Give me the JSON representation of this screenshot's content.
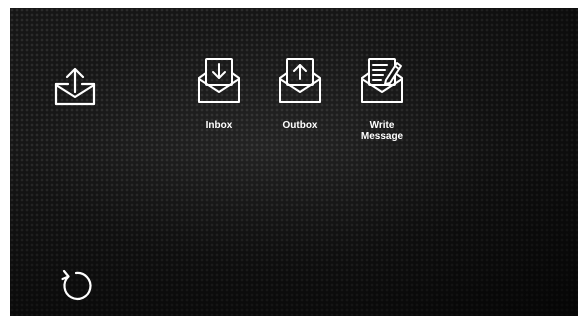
{
  "header": {
    "current_section_icon": "mail-share-icon"
  },
  "menu": {
    "items": [
      {
        "label": "Inbox",
        "icon": "inbox-icon"
      },
      {
        "label": "Outbox",
        "icon": "outbox-icon"
      },
      {
        "label": "Write\nMessage",
        "icon": "write-message-icon"
      }
    ]
  },
  "footer": {
    "refresh_icon": "refresh-icon"
  },
  "colors": {
    "background": "#161616",
    "foreground": "#ffffff"
  }
}
